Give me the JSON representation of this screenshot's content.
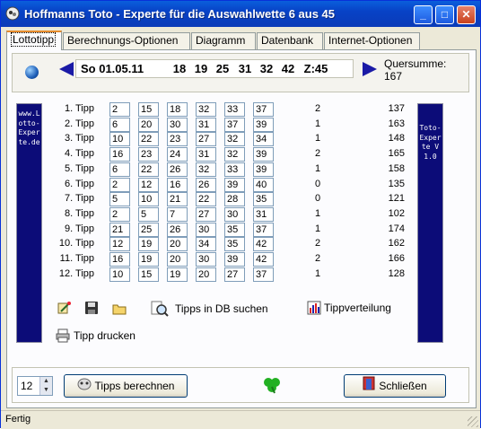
{
  "window": {
    "title": "Hoffmanns Toto - Experte für die Auswahlwette 6 aus 45",
    "minimize": "_",
    "maximize": "□",
    "close": "✕"
  },
  "tabs": [
    "Lottotipp",
    "Berechnungs-Optionen",
    "Diagramm",
    "Datenbank",
    "Internet-Optionen"
  ],
  "draw": {
    "date": "So 01.05.11",
    "numbers": [
      "18",
      "19",
      "25",
      "31",
      "32",
      "42"
    ],
    "extra": "Z:45"
  },
  "quersumme": {
    "label": "Quersumme:",
    "value": "167"
  },
  "sidebar_left": "www.Lotto-Experte.de",
  "sidebar_right": "Toto-Experte V1.0",
  "tipps": [
    {
      "label": "1. Tipp",
      "numbers": [
        "2",
        "15",
        "18",
        "32",
        "33",
        "37"
      ],
      "hits": "2",
      "sum": "137"
    },
    {
      "label": "2. Tipp",
      "numbers": [
        "6",
        "20",
        "30",
        "31",
        "37",
        "39"
      ],
      "hits": "1",
      "sum": "163"
    },
    {
      "label": "3. Tipp",
      "numbers": [
        "10",
        "22",
        "23",
        "27",
        "32",
        "34"
      ],
      "hits": "1",
      "sum": "148"
    },
    {
      "label": "4. Tipp",
      "numbers": [
        "16",
        "23",
        "24",
        "31",
        "32",
        "39"
      ],
      "hits": "2",
      "sum": "165"
    },
    {
      "label": "5. Tipp",
      "numbers": [
        "6",
        "22",
        "26",
        "32",
        "33",
        "39"
      ],
      "hits": "1",
      "sum": "158"
    },
    {
      "label": "6. Tipp",
      "numbers": [
        "2",
        "12",
        "16",
        "26",
        "39",
        "40"
      ],
      "hits": "0",
      "sum": "135"
    },
    {
      "label": "7. Tipp",
      "numbers": [
        "5",
        "10",
        "21",
        "22",
        "28",
        "35"
      ],
      "hits": "0",
      "sum": "121"
    },
    {
      "label": "8. Tipp",
      "numbers": [
        "2",
        "5",
        "7",
        "27",
        "30",
        "31"
      ],
      "hits": "1",
      "sum": "102"
    },
    {
      "label": "9. Tipp",
      "numbers": [
        "21",
        "25",
        "26",
        "30",
        "35",
        "37"
      ],
      "hits": "1",
      "sum": "174"
    },
    {
      "label": "10. Tipp",
      "numbers": [
        "12",
        "19",
        "20",
        "34",
        "35",
        "42"
      ],
      "hits": "2",
      "sum": "162"
    },
    {
      "label": "11. Tipp",
      "numbers": [
        "16",
        "19",
        "20",
        "30",
        "39",
        "42"
      ],
      "hits": "2",
      "sum": "166"
    },
    {
      "label": "12. Tipp",
      "numbers": [
        "10",
        "15",
        "19",
        "20",
        "27",
        "37"
      ],
      "hits": "1",
      "sum": "128"
    }
  ],
  "actions": {
    "search_db": "Tipps in DB suchen",
    "distribution": "Tippverteilung",
    "print": "Tipp drucken"
  },
  "bottom": {
    "count": "12",
    "calculate": "Tipps berechnen",
    "close": "Schließen"
  },
  "status": "Fertig",
  "icons": [
    "app-icon",
    "globe-icon",
    "prev-arrow-icon",
    "next-arrow-icon",
    "wand-icon",
    "save-icon",
    "open-folder-icon",
    "search-icon",
    "chart-icon",
    "printer-icon",
    "calculate-icon",
    "clover-icon",
    "close-door-icon"
  ]
}
